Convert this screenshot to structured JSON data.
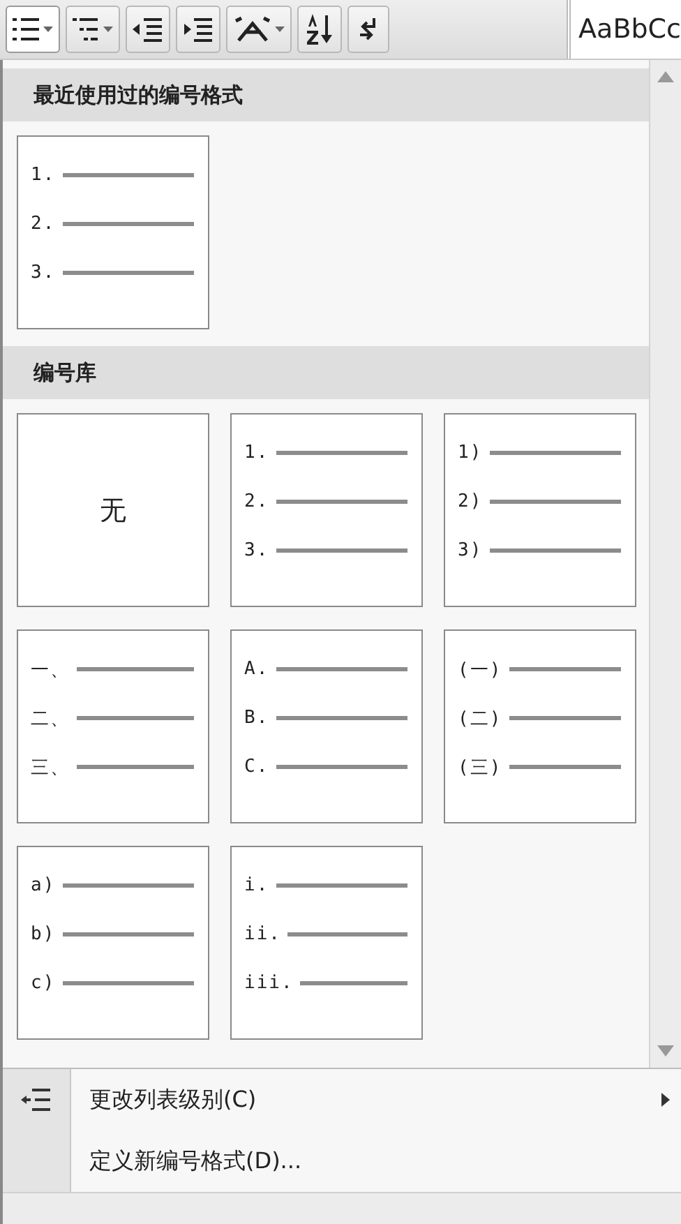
{
  "toolbar": {
    "buttons": [
      {
        "kind": "numbering",
        "pressed": true,
        "has_dropdown": true
      },
      {
        "kind": "multilevel",
        "pressed": false,
        "has_dropdown": true
      },
      {
        "kind": "decrease-indent",
        "pressed": false,
        "has_dropdown": false
      },
      {
        "kind": "increase-indent",
        "pressed": false,
        "has_dropdown": false
      },
      {
        "kind": "asian-layout",
        "pressed": false,
        "has_dropdown": true
      },
      {
        "kind": "sort",
        "pressed": false,
        "has_dropdown": false
      },
      {
        "kind": "paragraph-marks",
        "pressed": false,
        "has_dropdown": false
      }
    ],
    "style_preview": "AaBbCc"
  },
  "sections": [
    {
      "title": "最近使用过的编号格式",
      "tiles": [
        {
          "kind": "list",
          "markers": [
            "1.",
            "2.",
            "3."
          ]
        }
      ]
    },
    {
      "title": "编号库",
      "tiles": [
        {
          "kind": "none",
          "label": "无"
        },
        {
          "kind": "list",
          "markers": [
            "1.",
            "2.",
            "3."
          ]
        },
        {
          "kind": "list",
          "markers": [
            "1)",
            "2)",
            "3)"
          ]
        },
        {
          "kind": "list",
          "markers": [
            "一、",
            "二、",
            "三、"
          ]
        },
        {
          "kind": "list",
          "markers": [
            "A.",
            "B.",
            "C."
          ]
        },
        {
          "kind": "list",
          "markers": [
            "(一)",
            "(二)",
            "(三)"
          ]
        },
        {
          "kind": "list",
          "markers": [
            "a)",
            "b)",
            "c)"
          ]
        },
        {
          "kind": "list",
          "markers": [
            "i.",
            "ii.",
            "iii."
          ]
        }
      ]
    }
  ],
  "menu": [
    {
      "label": "更改列表级别(C)",
      "has_icon": true,
      "has_submenu": true
    },
    {
      "label": "定义新编号格式(D)...",
      "has_icon": false,
      "has_submenu": false
    }
  ]
}
